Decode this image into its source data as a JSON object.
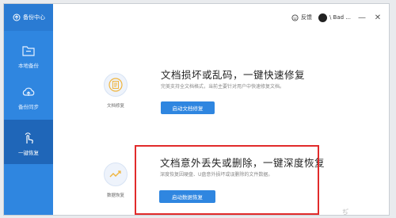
{
  "app": {
    "title": "备份中心"
  },
  "sidebar": {
    "items": [
      {
        "label": "本地备份",
        "icon": "folder-icon"
      },
      {
        "label": "备份同步",
        "icon": "cloud-upload-icon"
      },
      {
        "label": "一键恢复",
        "icon": "hand-click-icon"
      }
    ],
    "active_index": 2
  },
  "titlebar": {
    "feedback_label": "反馈",
    "user_name": "\\ Bad ...",
    "minimize_glyph": "—",
    "close_glyph": "✕"
  },
  "cards": [
    {
      "caption": "文档修复",
      "title": "文档损坏或乱码，一键快速修复",
      "desc": "完美支持全文档格式，当前主要针对用户中快速修复文档。",
      "button_label": "启动文档修复",
      "icon": "document-repair-icon"
    },
    {
      "caption": "数据恢复",
      "title": "文档意外丢失或删除，一键深度恢复",
      "desc": "深度恢复因硬盘、U盘意外损坏或误删除的文件数据。",
      "button_label": "启动数据恢复",
      "icon": "trend-line-icon"
    }
  ],
  "colors": {
    "sidebar": "#2f86e0",
    "sidebar_active": "#1f66b8",
    "button": "#2f86e0",
    "highlight": "#e12b2b"
  },
  "watermark": "ぢ"
}
